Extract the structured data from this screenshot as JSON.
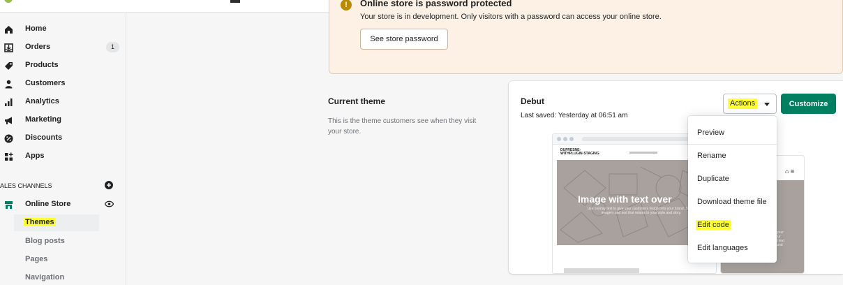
{
  "colors": {
    "accent": "#008060",
    "highlight": "#ffff33",
    "banner_bg": "#fdf1e5",
    "warning": "#b98900"
  },
  "sidebar": {
    "items": [
      {
        "label": "Home",
        "icon": "home-icon"
      },
      {
        "label": "Orders",
        "icon": "orders-icon",
        "badge": "1"
      },
      {
        "label": "Products",
        "icon": "tag-icon"
      },
      {
        "label": "Customers",
        "icon": "person-icon"
      },
      {
        "label": "Analytics",
        "icon": "bar-chart-icon"
      },
      {
        "label": "Marketing",
        "icon": "megaphone-icon"
      },
      {
        "label": "Discounts",
        "icon": "discount-icon"
      },
      {
        "label": "Apps",
        "icon": "apps-icon"
      }
    ],
    "sales_channels_label": "ALES CHANNELS",
    "channel": {
      "label": "Online Store",
      "icon": "store-icon"
    },
    "sub_items": [
      "Themes",
      "Blog posts",
      "Pages",
      "Navigation"
    ]
  },
  "banner": {
    "title": "Online store is password protected",
    "text": "Your store is in development. Only visitors with a password can access your online store.",
    "button": "See store password"
  },
  "current_theme": {
    "title": "Current theme",
    "description": "This is the theme customers see when they visit your store."
  },
  "theme_card": {
    "name": "Debut",
    "saved": "Last saved: Yesterday at 06:51 am",
    "actions_label": "Actions",
    "customize_label": "Customize",
    "preview": {
      "store_name": "DUFRESNE-WITHPLUGIN-STAGING",
      "hero_title": "Image with text over",
      "hero_subtitle": "Use overlay text to give your customers insight into your brand. Select imagery and text that relates to your style and story.",
      "mobile_text": "text"
    }
  },
  "actions_menu": [
    "Preview",
    "Rename",
    "Duplicate",
    "Download theme file",
    "Edit code",
    "Edit languages"
  ]
}
